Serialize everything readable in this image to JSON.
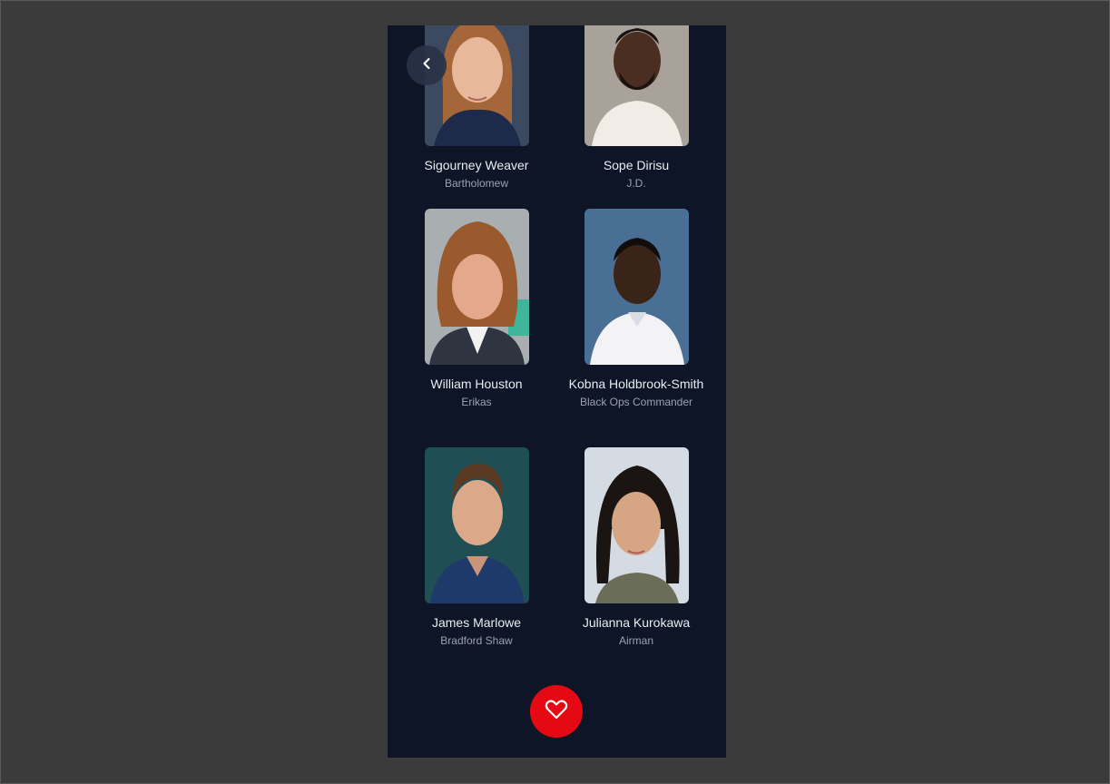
{
  "cast": [
    {
      "name": "Sigourney Weaver",
      "role": "Bartholomew",
      "photo": "portrait-woman-auburn-hair"
    },
    {
      "name": "Sope Dirisu",
      "role": "J.D.",
      "photo": "portrait-man-beard-white-shirt"
    },
    {
      "name": "William Houston",
      "role": "Erikas",
      "photo": "portrait-man-curly-red-hair"
    },
    {
      "name": "Kobna Holdbrook-Smith",
      "role": "Black Ops Commander",
      "photo": "portrait-man-white-polo"
    },
    {
      "name": "James Marlowe",
      "role": "Bradford Shaw",
      "photo": "portrait-man-blue-polo"
    },
    {
      "name": "Julianna Kurokawa",
      "role": "Airman",
      "photo": "portrait-woman-dark-hair"
    }
  ],
  "icons": {
    "back": "chevron-left-icon",
    "favorite": "heart-outline-icon"
  },
  "colors": {
    "background": "#0e1526",
    "accent": "#e50914",
    "text_primary": "#e9ecf2",
    "text_secondary": "#9aa3b5"
  }
}
